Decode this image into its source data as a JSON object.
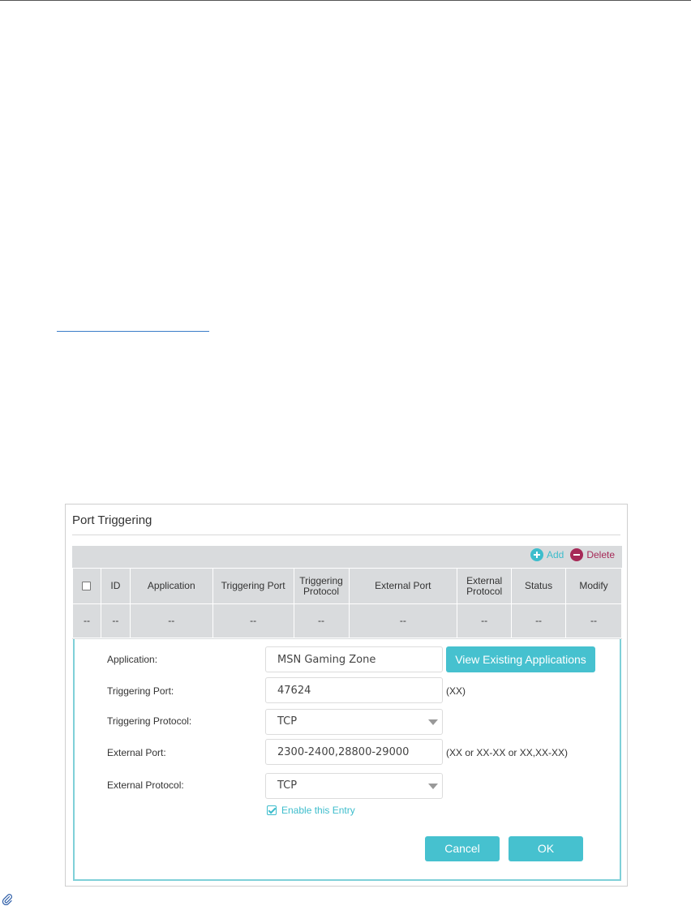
{
  "panel": {
    "title": "Port Triggering"
  },
  "toolbar": {
    "add_label": "Add",
    "delete_label": "Delete"
  },
  "table": {
    "columns": [
      "ID",
      "Application",
      "Triggering Port",
      "Triggering Protocol",
      "External Port",
      "External Protocol",
      "Status",
      "Modify"
    ],
    "rows": [
      [
        "--",
        "--",
        "--",
        "--",
        "--",
        "--",
        "--",
        "--",
        "--"
      ]
    ]
  },
  "form": {
    "application_label": "Application:",
    "application_value": "MSN Gaming Zone",
    "view_apps_label": "View Existing Applications",
    "triggering_port_label": "Triggering Port:",
    "triggering_port_value": "47624",
    "triggering_port_hint": "(XX)",
    "triggering_protocol_label": "Triggering Protocol:",
    "triggering_protocol_value": "TCP",
    "external_port_label": "External Port:",
    "external_port_value": "2300-2400,28800-29000",
    "external_port_hint": "(XX or XX-XX or XX,XX-XX)",
    "external_protocol_label": "External Protocol:",
    "external_protocol_value": "TCP",
    "enable_label": "Enable this Entry",
    "enable_checked": true,
    "cancel_label": "Cancel",
    "ok_label": "OK"
  },
  "colors": {
    "accent": "#46c1cf",
    "delete": "#a62957",
    "table_bg": "#d9dbdd",
    "form_border": "#7fd0d8"
  },
  "icons": {
    "add": "plus-circle-icon",
    "delete": "minus-circle-icon",
    "dropdown": "chevron-down-icon",
    "attachment": "paperclip-icon"
  }
}
